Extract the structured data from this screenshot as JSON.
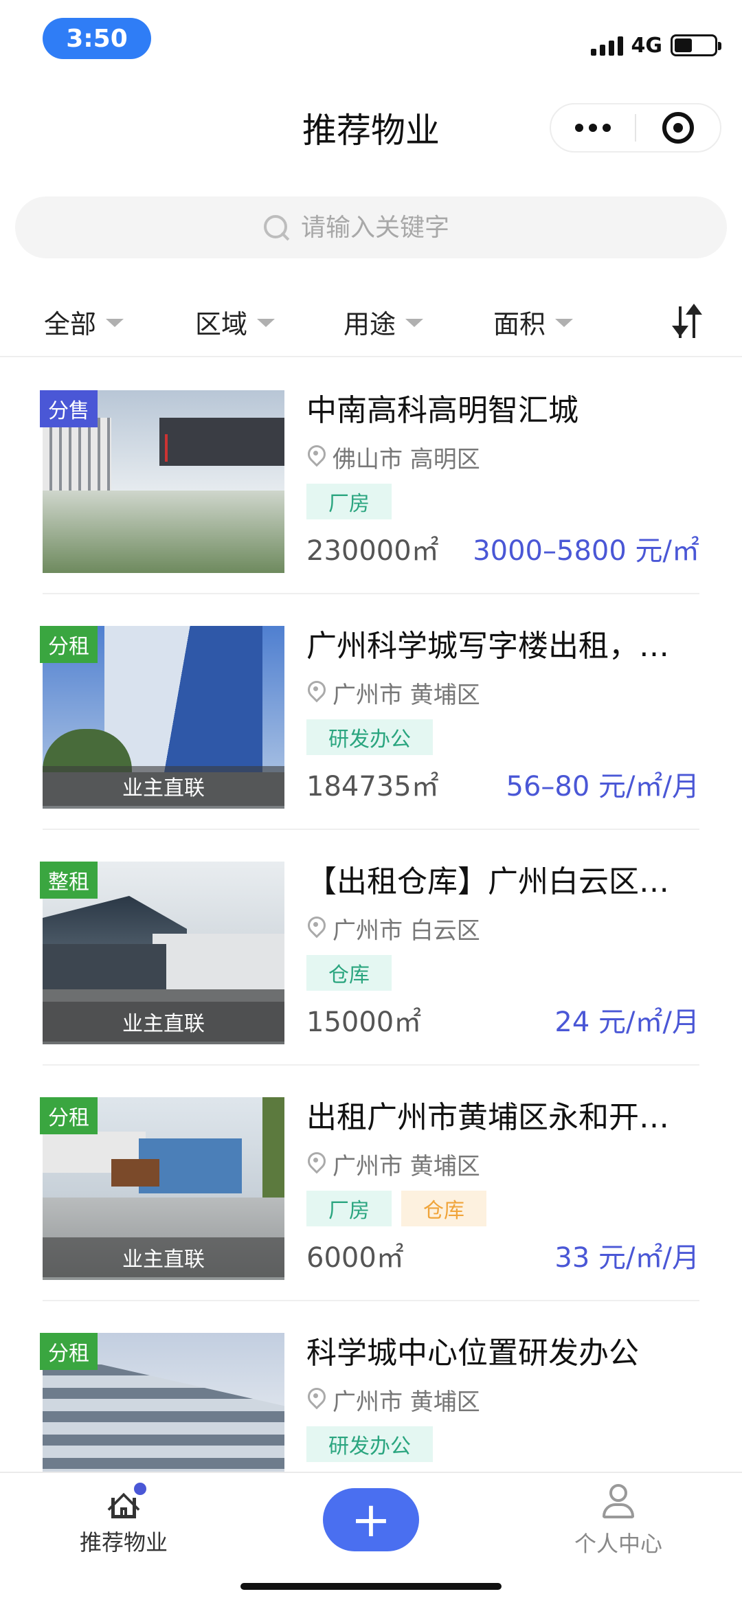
{
  "status_bar": {
    "time": "3:50",
    "network": "4G"
  },
  "header": {
    "title": "推荐物业"
  },
  "search": {
    "placeholder": "请输入关键字"
  },
  "filters": [
    "全部",
    "区域",
    "用途",
    "面积"
  ],
  "listings": [
    {
      "badge": "分售",
      "badge_color": "#4a57d6",
      "owner_direct": "",
      "title": "中南高科高明智汇城",
      "location": "佛山市 高明区",
      "tags": [
        {
          "label": "厂房",
          "style": "green"
        }
      ],
      "area": "230000㎡",
      "price": "3000–5800 元/㎡"
    },
    {
      "badge": "分租",
      "badge_color": "#3aa640",
      "owner_direct": "业主直联",
      "title": "广州科学城写字楼出租，…",
      "location": "广州市 黄埔区",
      "tags": [
        {
          "label": "研发办公",
          "style": "green"
        }
      ],
      "area": "184735㎡",
      "price": "56–80 元/㎡/月"
    },
    {
      "badge": "整租",
      "badge_color": "#3aa640",
      "owner_direct": "业主直联",
      "title": "【出租仓库】广州白云区…",
      "location": "广州市 白云区",
      "tags": [
        {
          "label": "仓库",
          "style": "green"
        }
      ],
      "area": "15000㎡",
      "price": "24 元/㎡/月"
    },
    {
      "badge": "分租",
      "badge_color": "#3aa640",
      "owner_direct": "业主直联",
      "title": "出租广州市黄埔区永和开…",
      "location": "广州市 黄埔区",
      "tags": [
        {
          "label": "厂房",
          "style": "green"
        },
        {
          "label": "仓库",
          "style": "orange"
        }
      ],
      "area": "6000㎡",
      "price": "33 元/㎡/月"
    },
    {
      "badge": "分租",
      "badge_color": "#3aa640",
      "owner_direct": "",
      "title": "科学城中心位置研发办公",
      "location": "广州市 黄埔区",
      "tags": [
        {
          "label": "研发办公",
          "style": "green"
        }
      ],
      "area": "",
      "price": ""
    }
  ],
  "bottom_nav": {
    "home_label": "推荐物业",
    "add_symbol": "+",
    "profile_label": "个人中心"
  },
  "colors": {
    "accent": "#4a57d6",
    "status_pill": "#2f7df6"
  }
}
